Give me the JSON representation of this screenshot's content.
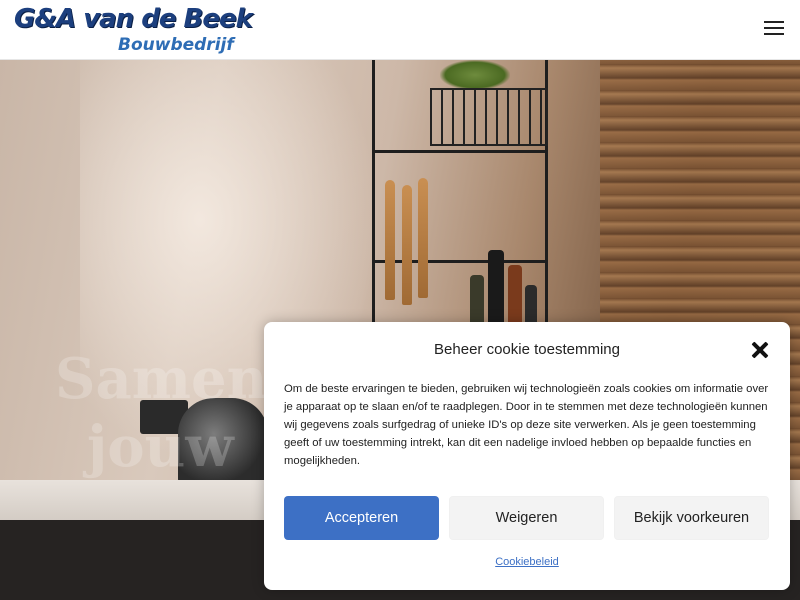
{
  "header": {
    "logo_main": "G&A van de Beek",
    "logo_sub": "Bouwbedrijf",
    "menu_icon": "hamburger-menu-icon"
  },
  "hero": {
    "title_line1": "Samen",
    "title_line2": "jouw"
  },
  "cookie_modal": {
    "title": "Beheer cookie toestemming",
    "body": "Om de beste ervaringen te bieden, gebruiken wij technologieën zoals cookies om informatie over je apparaat op te slaan en/of te raadplegen. Door in te stemmen met deze technologieën kunnen wij gegevens zoals surfgedrag of unieke ID's op deze site verwerken. Als je geen toestemming geeft of uw toestemming intrekt, kan dit een nadelige invloed hebben op bepaalde functies en mogelijkheden.",
    "accept_label": "Accepteren",
    "deny_label": "Weigeren",
    "preferences_label": "Bekijk voorkeuren",
    "policy_link": "Cookiebeleid",
    "close_icon": "close-icon"
  },
  "colors": {
    "accent": "#3d70c5",
    "logo_dark": "#1c3f7e",
    "logo_light": "#2e6db5"
  }
}
